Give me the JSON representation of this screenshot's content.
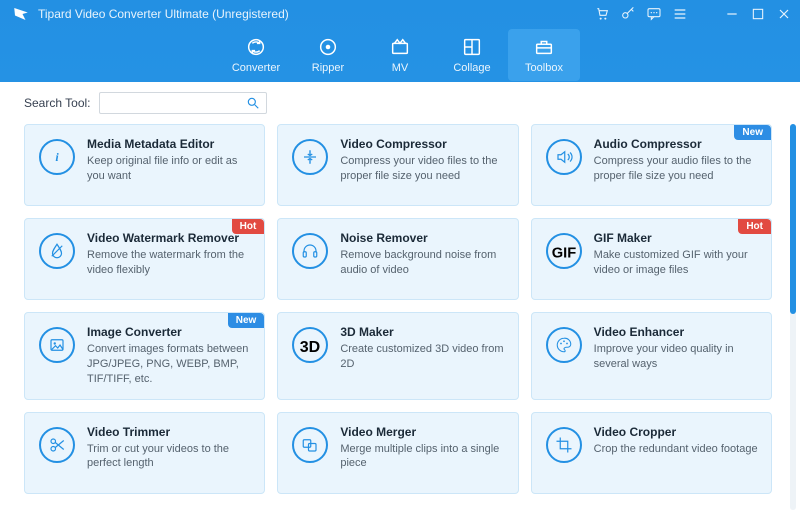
{
  "window": {
    "title": "Tipard Video Converter Ultimate (Unregistered)"
  },
  "titlebar_icons": {
    "cart": "cart-icon",
    "key": "key-icon",
    "feedback": "speech-bubble-icon",
    "menu": "hamburger-icon",
    "minimize": "minimize-icon",
    "maximize": "maximize-icon",
    "close": "close-icon"
  },
  "nav": {
    "tabs": [
      {
        "id": "converter",
        "label": "Converter"
      },
      {
        "id": "ripper",
        "label": "Ripper"
      },
      {
        "id": "mv",
        "label": "MV"
      },
      {
        "id": "collage",
        "label": "Collage"
      },
      {
        "id": "toolbox",
        "label": "Toolbox"
      }
    ],
    "active": "toolbox"
  },
  "search": {
    "label": "Search Tool:",
    "value": "",
    "placeholder": ""
  },
  "colors": {
    "header": "#2390e3",
    "card_bg": "#eaf5fd",
    "hot_badge": "#e24a41",
    "new_badge": "#2d8de4"
  },
  "tools": [
    {
      "id": "media-metadata-editor",
      "icon": "info-icon",
      "title": "Media Metadata Editor",
      "desc": "Keep original file info or edit as you want"
    },
    {
      "id": "video-compressor",
      "icon": "compress-icon",
      "title": "Video Compressor",
      "desc": "Compress your video files to the proper file size you need"
    },
    {
      "id": "audio-compressor",
      "icon": "audio-icon",
      "title": "Audio Compressor",
      "desc": "Compress your audio files to the proper file size you need",
      "badge": "New"
    },
    {
      "id": "video-watermark-remover",
      "icon": "droplet-icon",
      "title": "Video Watermark Remover",
      "desc": "Remove the watermark from the video flexibly",
      "badge": "Hot"
    },
    {
      "id": "noise-remover",
      "icon": "headphones-icon",
      "title": "Noise Remover",
      "desc": "Remove background noise from audio of video"
    },
    {
      "id": "gif-maker",
      "icon": "gif-icon",
      "title": "GIF Maker",
      "desc": "Make customized GIF with your video or image files",
      "badge": "Hot"
    },
    {
      "id": "image-converter",
      "icon": "image-icon",
      "title": "Image Converter",
      "desc": "Convert images formats between JPG/JPEG, PNG, WEBP, BMP, TIF/TIFF, etc.",
      "badge": "New"
    },
    {
      "id": "3d-maker",
      "icon": "three-d-icon",
      "title": "3D Maker",
      "desc": "Create customized 3D video from 2D"
    },
    {
      "id": "video-enhancer",
      "icon": "palette-icon",
      "title": "Video Enhancer",
      "desc": "Improve your video quality in several ways"
    },
    {
      "id": "video-trimmer",
      "icon": "scissors-icon",
      "title": "Video Trimmer",
      "desc": "Trim or cut your videos to the perfect length"
    },
    {
      "id": "video-merger",
      "icon": "merge-icon",
      "title": "Video Merger",
      "desc": "Merge multiple clips into a single piece"
    },
    {
      "id": "video-cropper",
      "icon": "crop-icon",
      "title": "Video Cropper",
      "desc": "Crop the redundant video footage"
    }
  ]
}
